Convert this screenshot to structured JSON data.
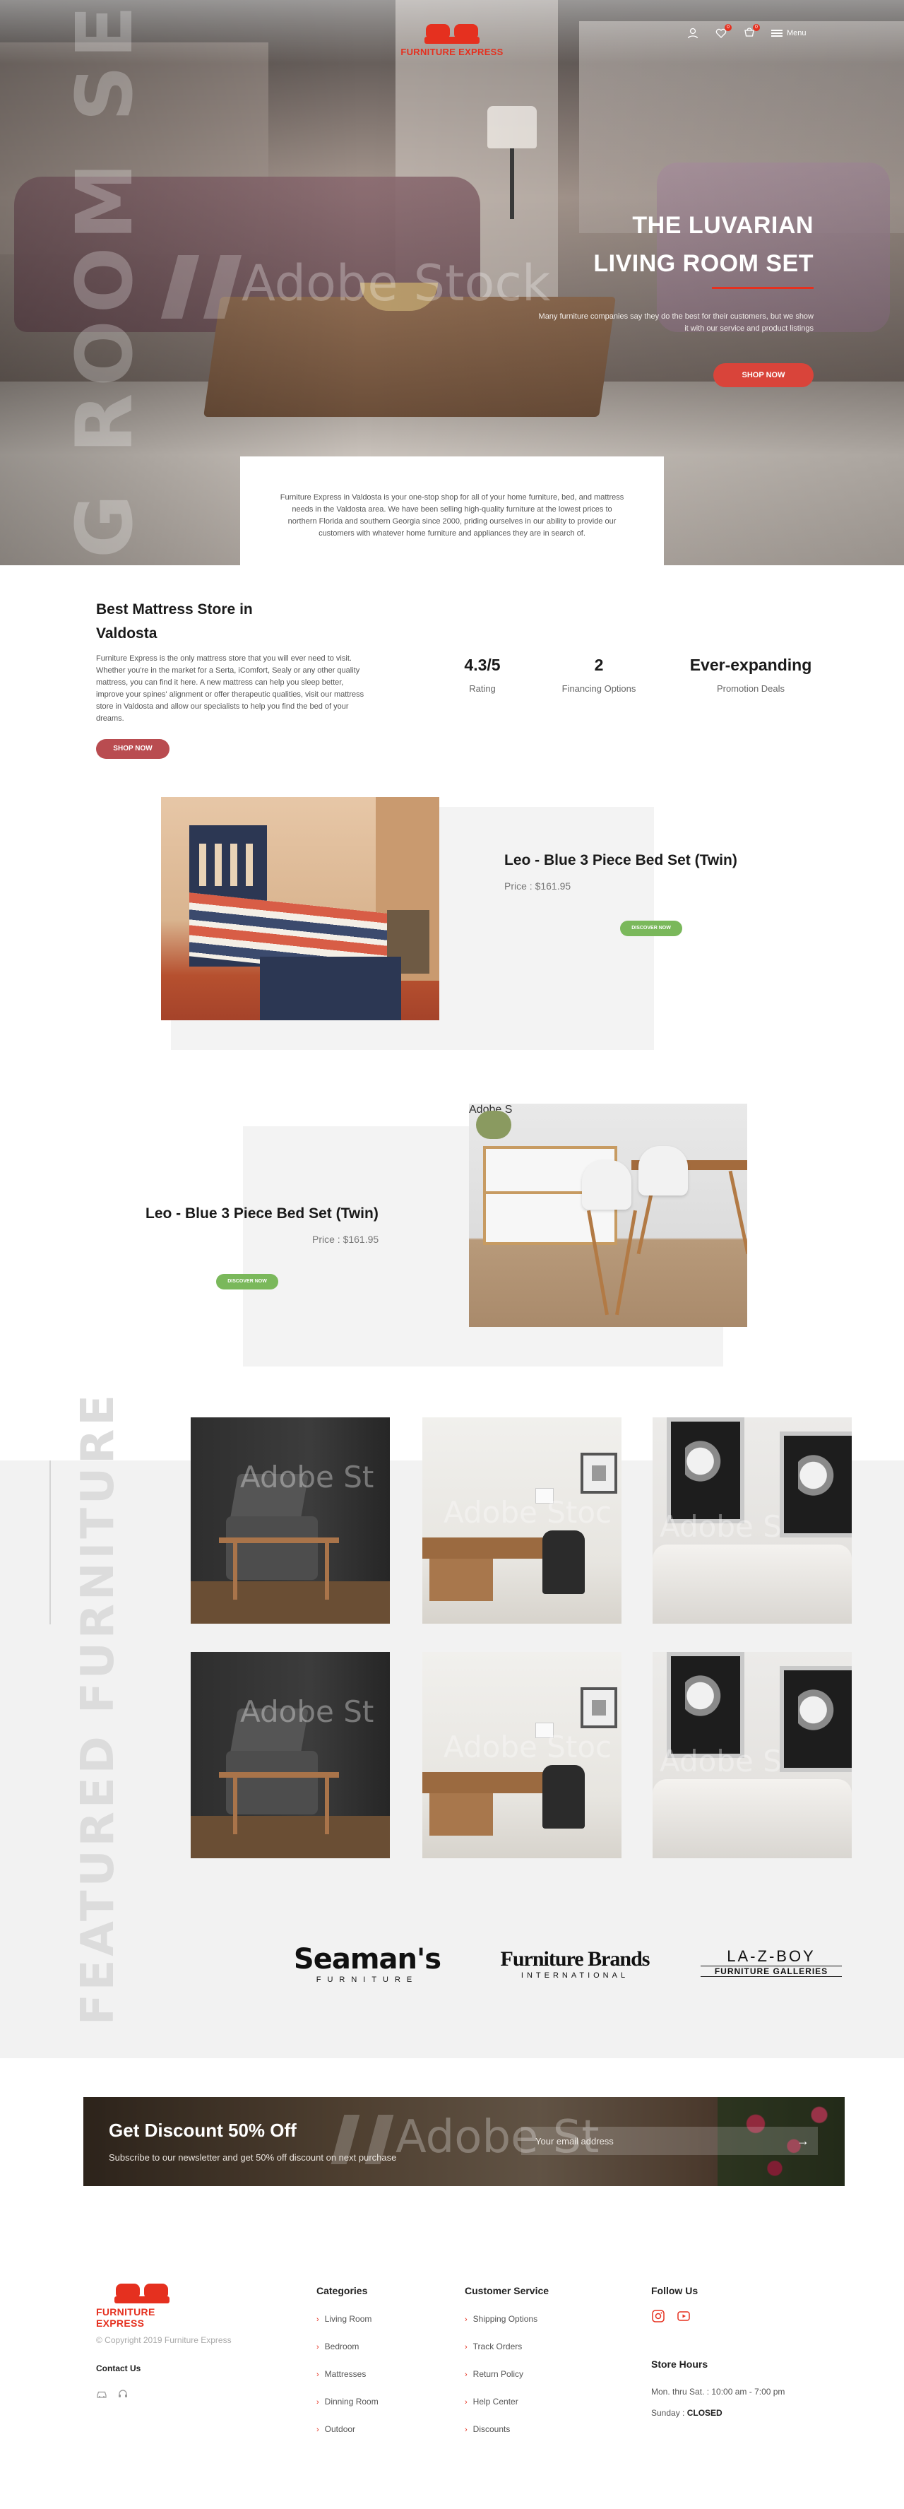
{
  "header": {
    "brand": "FURNITURE EXPRESS",
    "menu_label": "Menu",
    "cart_count": "0",
    "wishlist_count": "0"
  },
  "hero": {
    "vertical_text": "G ROOM SET",
    "watermark": "Adobe Stock",
    "title_line1": "THE LUVARIAN",
    "title_line2": "LIVING ROOM SET",
    "subtitle": "Many furniture companies say they do the best for their customers, but we show it with our service and product listings",
    "button": "SHOP NOW"
  },
  "intro": {
    "text": "Furniture Express in Valdosta is your one-stop shop for all of your home furniture, bed, and mattress needs in the Valdosta area. We have been selling high-quality furniture at the lowest prices to northern Florida and southern Georgia since 2000, priding ourselves in our ability to provide our customers with whatever home furniture and appliances they are in search of."
  },
  "about": {
    "title": "Best Mattress Store in Valdosta",
    "text": "Furniture Express is the only mattress store that you will ever need to visit. Whether you're in the market for a Serta, iComfort, Sealy or any other quality mattress, you can find it here. A new mattress can help you sleep better, improve your spines' alignment or offer therapeutic qualities, visit our mattress store in Valdosta and allow our specialists to help you find the bed of your dreams.",
    "button": "SHOP NOW",
    "stats": [
      {
        "value": "4.3/5",
        "label": "Rating"
      },
      {
        "value": "2",
        "label": "Financing Options"
      },
      {
        "value": "Ever-expanding",
        "label": "Promotion Deals"
      }
    ]
  },
  "products": [
    {
      "name": "Leo - Blue 3 Piece Bed Set (Twin)",
      "price": "Price : $161.95",
      "button": "DISCOVER NOW"
    },
    {
      "name": "Leo - Blue 3 Piece Bed Set (Twin)",
      "price": "Price : $161.95",
      "button": "DISCOVER NOW",
      "watermark": "Adobe S"
    }
  ],
  "featured": {
    "vertical_text": "FEATURED FURNITURE",
    "watermarks": [
      "Adobe St",
      "Adobe Stoc",
      "Adobe S"
    ]
  },
  "brands": [
    {
      "name": "Seaman's",
      "sub": "FURNITURE"
    },
    {
      "name": "Furniture Brands",
      "sub": "INTERNATIONAL"
    },
    {
      "name": "LA-Z-BOY",
      "sub": "FURNITURE GALLERIES"
    }
  ],
  "newsletter": {
    "title": "Get Discount 50% Off",
    "subtitle": "Subscribe to our newsletter and get 50% off discount on next purchase",
    "placeholder": "Your email address",
    "watermark": "Adobe St",
    "arrow": "→"
  },
  "footer": {
    "brand": "FURNITURE EXPRESS",
    "copyright": "© Copyright 2019 Furniture Express",
    "contact_title": "Contact Us",
    "categories_title": "Categories",
    "categories": [
      "Living Room",
      "Bedroom",
      "Mattresses",
      "Dinning Room",
      "Outdoor"
    ],
    "service_title": "Customer Service",
    "service": [
      "Shipping Options",
      "Track Orders",
      "Return Policy",
      "Help Center",
      "Discounts"
    ],
    "follow_title": "Follow Us",
    "hours_title": "Store Hours",
    "hours_weekday": "Mon. thru Sat. : 10:00 am - 7:00 pm",
    "hours_sunday_label": "Sunday :",
    "hours_sunday_value": "CLOSED"
  },
  "colors": {
    "accent": "#e5301f",
    "button_red": "#d9443a",
    "button_green": "#7ab85b",
    "light_grey": "#f3f3f3"
  }
}
